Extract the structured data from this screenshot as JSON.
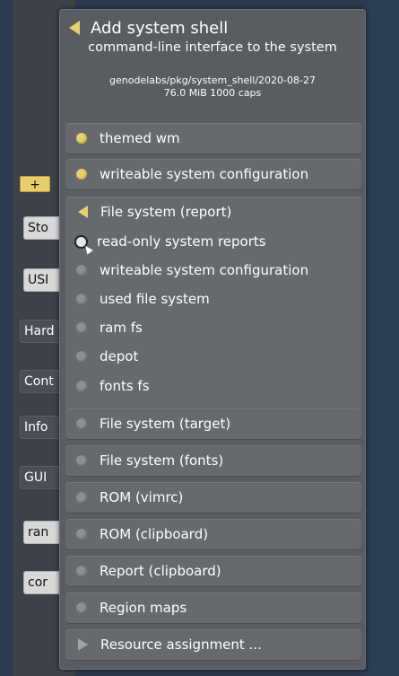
{
  "background": {
    "plus_label": "+",
    "buttons": [
      {
        "label": "Sto",
        "style": "light"
      },
      {
        "label": "USI",
        "style": "light"
      },
      {
        "label": "Hard",
        "style": "dark"
      },
      {
        "label": "Cont",
        "style": "dark"
      },
      {
        "label": "Info",
        "style": "dark"
      },
      {
        "label": "GUI",
        "style": "dark"
      },
      {
        "label": "ran",
        "style": "light"
      },
      {
        "label": "cor",
        "style": "light"
      }
    ]
  },
  "popup": {
    "title": "Add system shell",
    "subtitle": "command-line interface to the system",
    "package_path": "genodelabs/pkg/system_shell/2020-08-27",
    "package_info": "76.0 MiB 1000 caps",
    "rows_top": [
      {
        "label": "themed wm",
        "bullet": "yellow"
      },
      {
        "label": "writeable system configuration",
        "bullet": "yellow"
      }
    ],
    "expanded": {
      "label": "File system (report)",
      "options": [
        {
          "label": "read-only system reports",
          "state": "hover"
        },
        {
          "label": "writeable system configuration",
          "state": "off"
        },
        {
          "label": "used file system",
          "state": "off"
        },
        {
          "label": "ram fs",
          "state": "off"
        },
        {
          "label": "depot",
          "state": "off"
        },
        {
          "label": "fonts fs",
          "state": "off"
        }
      ]
    },
    "rows_bottom": [
      {
        "label": "File system (target)"
      },
      {
        "label": "File system (fonts)"
      },
      {
        "label": "ROM (vimrc)"
      },
      {
        "label": "ROM (clipboard)"
      },
      {
        "label": "Report (clipboard)"
      },
      {
        "label": "Region maps"
      }
    ],
    "footer": "Resource assignment ..."
  },
  "colors": {
    "accent": "#e8d070",
    "popup_bg": "#595c60",
    "row_bg": "#66696d",
    "desktop_bg": "#2b3a4c"
  }
}
